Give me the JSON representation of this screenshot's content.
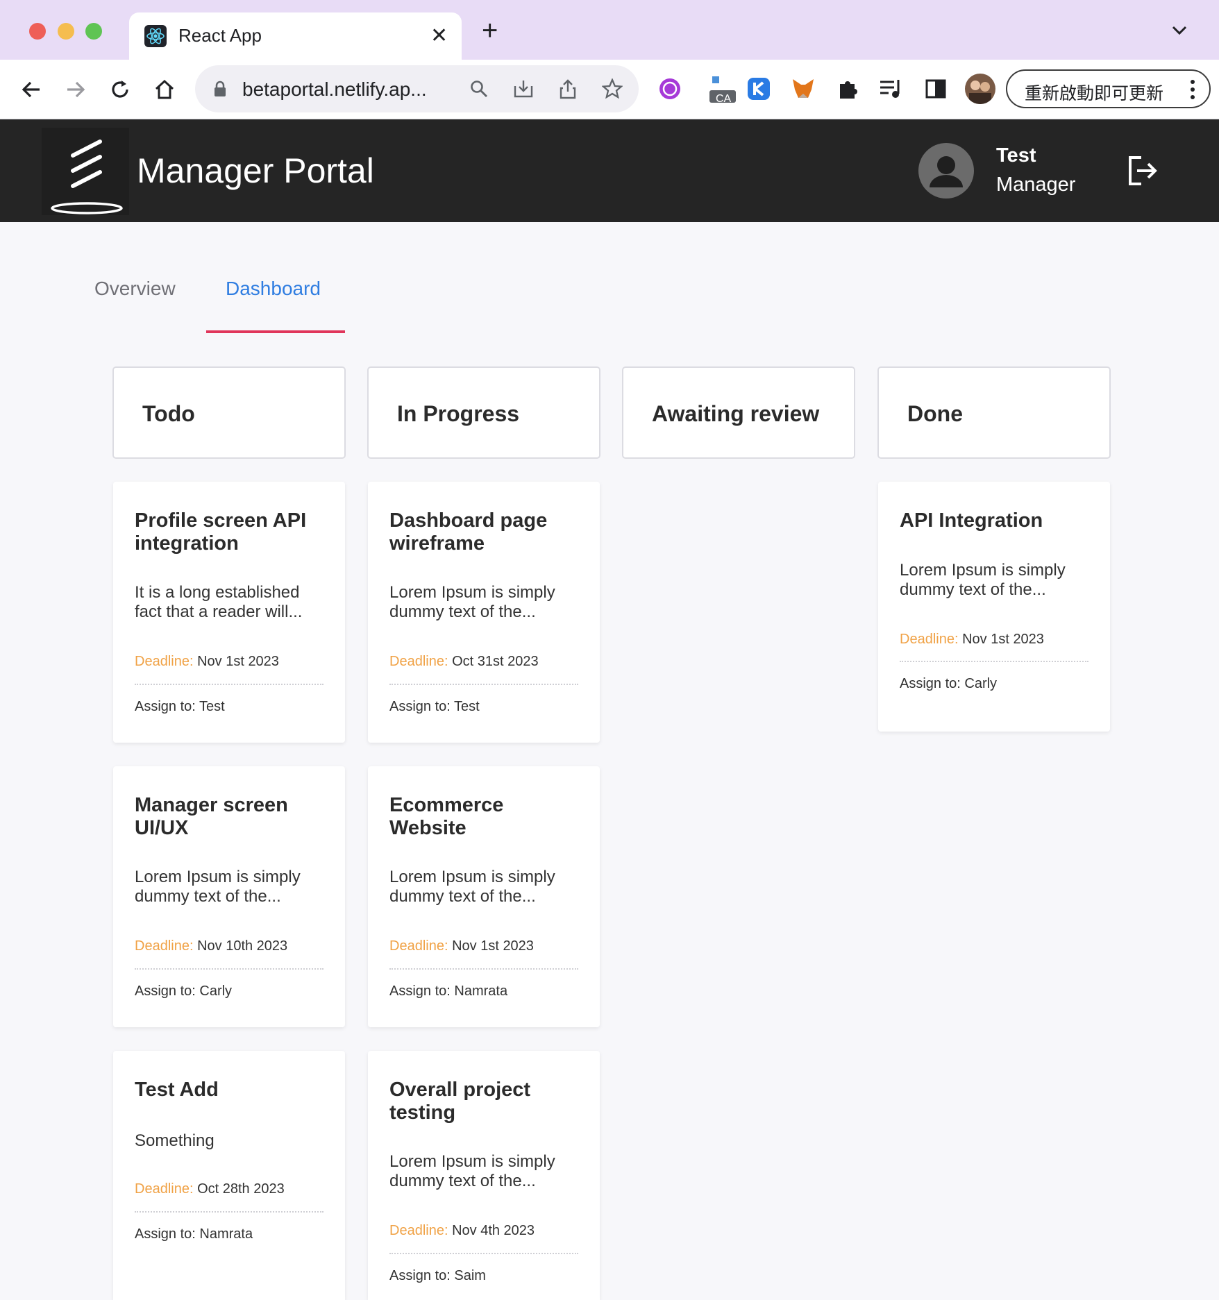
{
  "browser": {
    "tab_title": "React App",
    "url": "betaportal.netlify.ap...",
    "update_label": "重新啟動即可更新",
    "ext_badge": "CA"
  },
  "header": {
    "title": "Manager Portal",
    "user_name": "Test",
    "user_role": "Manager"
  },
  "tabs": [
    {
      "label": "Overview",
      "active": false
    },
    {
      "label": "Dashboard",
      "active": true
    }
  ],
  "columns": [
    {
      "title": "Todo",
      "cards": [
        {
          "title": "Profile screen API integration",
          "desc": "It is a long established fact that a reader will...",
          "deadline_label": "Deadline:",
          "deadline": "Nov 1st 2023",
          "assign": "Assign to: Test"
        },
        {
          "title": "Manager screen UI/UX",
          "desc": "Lorem Ipsum is simply dummy text of the...",
          "deadline_label": "Deadline:",
          "deadline": "Nov 10th 2023",
          "assign": "Assign to: Carly"
        },
        {
          "title": "Test Add",
          "desc": "Something",
          "deadline_label": "Deadline:",
          "deadline": "Oct 28th 2023",
          "assign": "Assign to: Namrata"
        }
      ]
    },
    {
      "title": "In Progress",
      "cards": [
        {
          "title": "Dashboard page wireframe",
          "desc": "Lorem Ipsum is simply dummy text of the...",
          "deadline_label": "Deadline:",
          "deadline": "Oct 31st 2023",
          "assign": "Assign to: Test"
        },
        {
          "title": "Ecommerce Website",
          "desc": "Lorem Ipsum is simply dummy text of the...",
          "deadline_label": "Deadline:",
          "deadline": "Nov 1st 2023",
          "assign": "Assign to: Namrata"
        },
        {
          "title": "Overall project testing",
          "desc": "Lorem Ipsum is simply dummy text of the...",
          "deadline_label": "Deadline:",
          "deadline": "Nov 4th 2023",
          "assign": "Assign to: Saim"
        }
      ]
    },
    {
      "title": "Awaiting review",
      "cards": []
    },
    {
      "title": "Done",
      "cards": [
        {
          "title": "API Integration",
          "desc": "Lorem Ipsum is simply dummy text of the...",
          "deadline_label": "Deadline:",
          "deadline": "Nov 1st 2023",
          "assign": "Assign to: Carly"
        }
      ]
    }
  ],
  "colors": {
    "header_bg": "#252525",
    "tab_active": "#2f7de1",
    "tab_indicator": "#e0355a",
    "deadline_label": "#f0a246"
  }
}
